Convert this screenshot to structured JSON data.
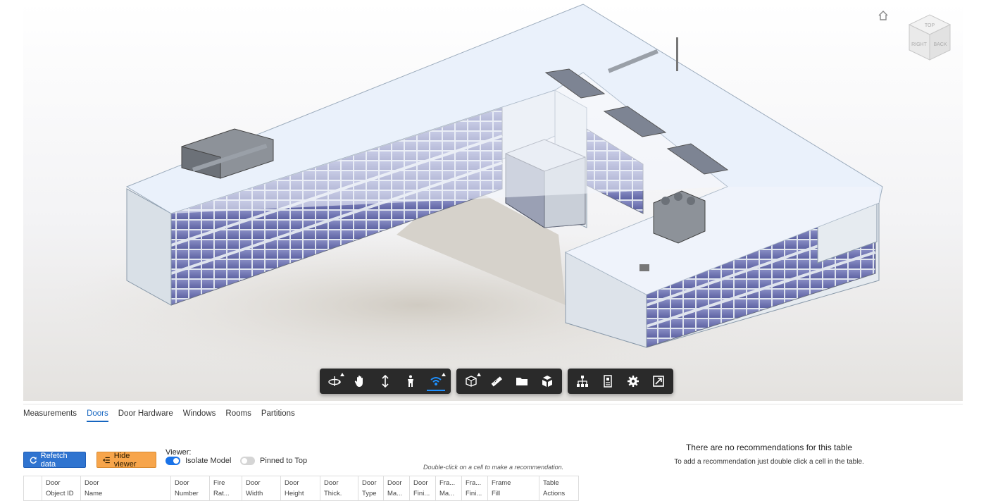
{
  "viewer": {
    "home_icon": "home-icon",
    "viewcube": {
      "face_top": "TOP",
      "face_right": "RIGHT",
      "face_back": "BACK"
    },
    "toolbar": {
      "groups": [
        [
          {
            "name": "orbit-icon",
            "active": false,
            "has_menu": true
          },
          {
            "name": "pan-icon",
            "active": false,
            "has_menu": false
          },
          {
            "name": "zoom-icon",
            "active": false,
            "has_menu": false
          },
          {
            "name": "first-person-icon",
            "active": false,
            "has_menu": false
          },
          {
            "name": "camera-interactions-icon",
            "active": true,
            "has_menu": true
          }
        ],
        [
          {
            "name": "section-analysis-icon",
            "active": false,
            "has_menu": true
          },
          {
            "name": "measure-icon",
            "active": false,
            "has_menu": false
          },
          {
            "name": "folder-icon",
            "active": false,
            "has_menu": false
          },
          {
            "name": "explode-model-icon",
            "active": false,
            "has_menu": false
          }
        ],
        [
          {
            "name": "model-browser-icon",
            "active": false,
            "has_menu": false
          },
          {
            "name": "properties-icon",
            "active": false,
            "has_menu": false
          },
          {
            "name": "settings-gear-icon",
            "active": false,
            "has_menu": false
          },
          {
            "name": "fullscreen-icon",
            "active": false,
            "has_menu": false
          }
        ]
      ]
    }
  },
  "tabs": [
    {
      "label": "Measurements",
      "active": false
    },
    {
      "label": "Doors",
      "active": true
    },
    {
      "label": "Door Hardware",
      "active": false
    },
    {
      "label": "Windows",
      "active": false
    },
    {
      "label": "Rooms",
      "active": false
    },
    {
      "label": "Partitions",
      "active": false
    }
  ],
  "controls": {
    "refetch_label": "Refetch data",
    "refetch_icon": "refresh-icon",
    "hide_viewer_label": "Hide viewer",
    "hide_viewer_icon": "collapse-list-icon",
    "viewer_label": "Viewer:",
    "isolate_model_label": "Isolate Model",
    "isolate_model_on": true,
    "pinned_to_top_label": "Pinned to Top",
    "pinned_to_top_on": false,
    "hint": "Double-click on a cell to make a recommendation."
  },
  "recommendations": {
    "title": "There are no recommendations for this table",
    "subtitle": "To add a recommendation just double click a cell in the table."
  },
  "table": {
    "columns": [
      {
        "line1": "",
        "line2": ""
      },
      {
        "line1": "Door",
        "line2": "Object ID"
      },
      {
        "line1": "Door",
        "line2": "Name"
      },
      {
        "line1": "Door",
        "line2": "Number"
      },
      {
        "line1": "Fire",
        "line2": "Rat..."
      },
      {
        "line1": "Door",
        "line2": "Width"
      },
      {
        "line1": "Door",
        "line2": "Height"
      },
      {
        "line1": "Door",
        "line2": "Thick."
      },
      {
        "line1": "Door",
        "line2": "Type"
      },
      {
        "line1": "Door",
        "line2": "Ma..."
      },
      {
        "line1": "Door",
        "line2": "Fini..."
      },
      {
        "line1": "Fra...",
        "line2": "Ma..."
      },
      {
        "line1": "Fra...",
        "line2": "Fini..."
      },
      {
        "line1": "Frame",
        "line2": "Fill"
      },
      {
        "line1": "Table",
        "line2": "Actions"
      }
    ]
  }
}
